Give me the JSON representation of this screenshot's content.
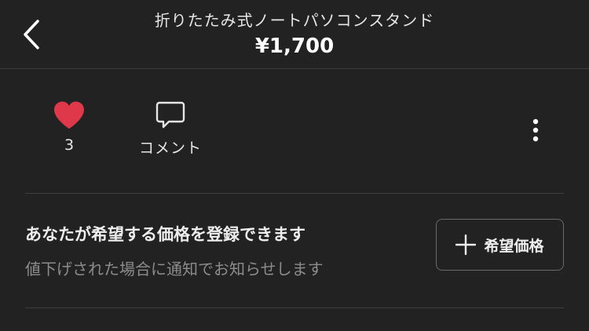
{
  "header": {
    "title": "折りたたみ式ノートパソコンスタンド",
    "price": "¥1,700",
    "back_icon": "chevron-left-icon"
  },
  "actions": {
    "like_icon": "heart-icon",
    "like_count": "3",
    "like_color": "#e0384b",
    "comment_icon": "comment-icon",
    "comment_label": "コメント",
    "more_icon": "more-vertical-icon"
  },
  "wish_price": {
    "title": "あなたが希望する価格を登録できます",
    "subtitle": "値下げされた場合に通知でお知らせします",
    "button_icon": "plus-icon",
    "button_label": "希望価格"
  }
}
